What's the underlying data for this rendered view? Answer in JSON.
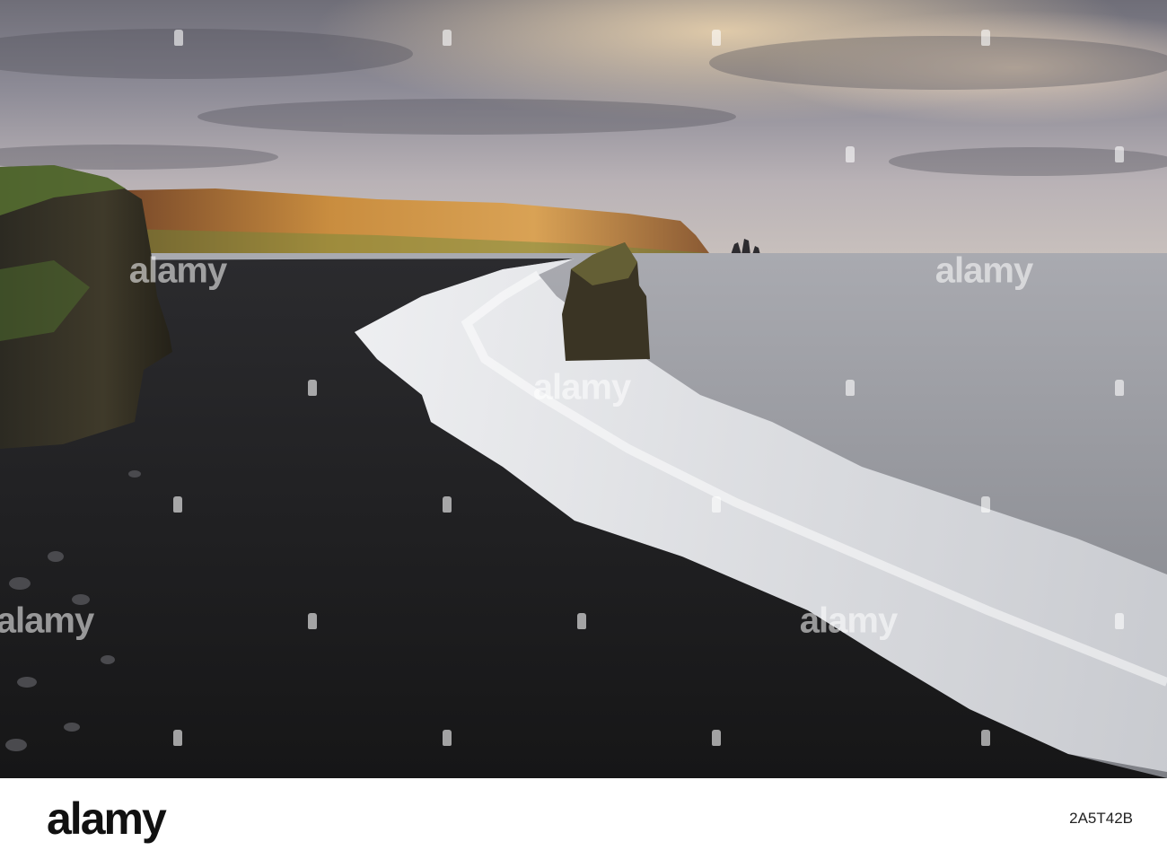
{
  "watermark": {
    "text": "alamy"
  },
  "footer": {
    "brand": "alamy",
    "image_id": "2A5T42B"
  },
  "scene": {
    "elements": [
      "cloudy-sky",
      "golden-sunlit-headland",
      "black-sand-beach",
      "sea-stack",
      "distant-sea-stacks",
      "long-exposure-waves",
      "mossy-cliff"
    ]
  },
  "colors": {
    "sky": "#8e8c97",
    "headland": "#c98d3f",
    "sea": "#9a9ca2",
    "sand": "#1e1e20",
    "surf": "#e6e7ea",
    "footer_bg": "#ffffff"
  }
}
